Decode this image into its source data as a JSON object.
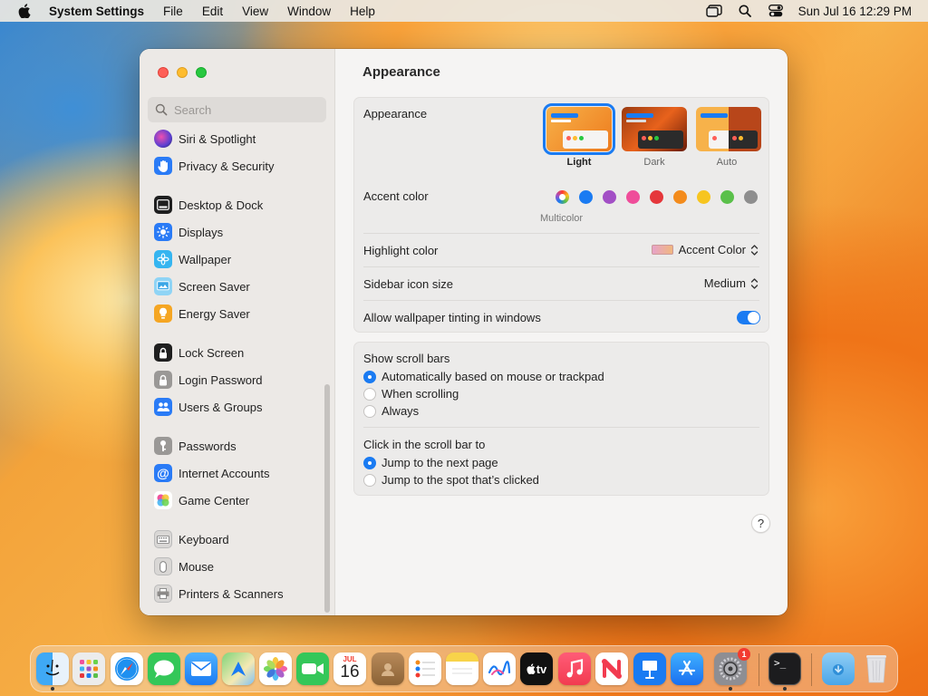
{
  "menubar": {
    "app_name": "System Settings",
    "menus": [
      "File",
      "Edit",
      "View",
      "Window",
      "Help"
    ],
    "clock": "Sun Jul 16  12:29 PM"
  },
  "sidebar": {
    "search_placeholder": "Search",
    "items": [
      {
        "label": "Siri & Spotlight",
        "icon": "siri-icon",
        "color": "#5b3fd1"
      },
      {
        "label": "Privacy & Security",
        "icon": "hand-icon",
        "color": "#2a7bf6"
      },
      {
        "label": "Desktop & Dock",
        "icon": "dock-icon",
        "color": "#1f1f1f"
      },
      {
        "label": "Displays",
        "icon": "sun-icon",
        "color": "#2a7bf6"
      },
      {
        "label": "Wallpaper",
        "icon": "flower-icon",
        "color": "#35b5f0"
      },
      {
        "label": "Screen Saver",
        "icon": "screen-saver-icon",
        "color": "#5ac8fa"
      },
      {
        "label": "Energy Saver",
        "icon": "lightbulb-icon",
        "color": "#f5a623"
      },
      {
        "label": "Lock Screen",
        "icon": "lock-icon",
        "color": "#1f1f1f"
      },
      {
        "label": "Login Password",
        "icon": "lock-icon",
        "color": "#8e8e93"
      },
      {
        "label": "Users & Groups",
        "icon": "users-icon",
        "color": "#2a7bf6"
      },
      {
        "label": "Passwords",
        "icon": "key-icon",
        "color": "#8e8e93"
      },
      {
        "label": "Internet Accounts",
        "icon": "at-icon",
        "color": "#2a7bf6"
      },
      {
        "label": "Game Center",
        "icon": "game-center-icon",
        "color": "#ffffff"
      },
      {
        "label": "Keyboard",
        "icon": "keyboard-icon",
        "color": "#d4d2d0"
      },
      {
        "label": "Mouse",
        "icon": "mouse-icon",
        "color": "#d4d2d0"
      },
      {
        "label": "Printers & Scanners",
        "icon": "printer-icon",
        "color": "#d4d2d0"
      }
    ]
  },
  "main": {
    "title": "Appearance",
    "appearance_label": "Appearance",
    "appearance_options": [
      {
        "label": "Light",
        "selected": true
      },
      {
        "label": "Dark",
        "selected": false
      },
      {
        "label": "Auto",
        "selected": false
      }
    ],
    "accent_label": "Accent color",
    "accent_caption": "Multicolor",
    "accent_colors": [
      "#ff3b30",
      "#1a7bf2",
      "#a24fc5",
      "#ef4d9a",
      "#e5373b",
      "#f38b1c",
      "#f7c51f",
      "#5ac04a",
      "#8e8e8e"
    ],
    "highlight_label": "Highlight color",
    "highlight_value": "Accent Color",
    "icon_size_label": "Sidebar icon size",
    "icon_size_value": "Medium",
    "tinting_label": "Allow wallpaper tinting in windows",
    "tinting_on": true,
    "scroll_bars_label": "Show scroll bars",
    "scroll_bars_options": [
      {
        "label": "Automatically based on mouse or trackpad",
        "selected": true
      },
      {
        "label": "When scrolling",
        "selected": false
      },
      {
        "label": "Always",
        "selected": false
      }
    ],
    "click_label": "Click in the scroll bar to",
    "click_options": [
      {
        "label": "Jump to the next page",
        "selected": true
      },
      {
        "label": "Jump to the spot that’s clicked",
        "selected": false
      }
    ],
    "help": "?"
  },
  "dock": {
    "calendar_month": "JUL",
    "calendar_day": "16",
    "tv_label": "tv",
    "settings_badge": "1",
    "apps": [
      "finder-icon",
      "launchpad-icon",
      "safari-icon",
      "messages-icon",
      "mail-icon",
      "maps-icon",
      "photos-icon",
      "facetime-icon",
      "calendar-icon",
      "contacts-icon",
      "reminders-icon",
      "notes-icon",
      "freeform-icon",
      "tv-icon",
      "music-icon",
      "news-icon",
      "keynote-icon",
      "app-store-icon",
      "system-settings-icon",
      "terminal-icon",
      "downloads-icon",
      "trash-icon"
    ]
  }
}
